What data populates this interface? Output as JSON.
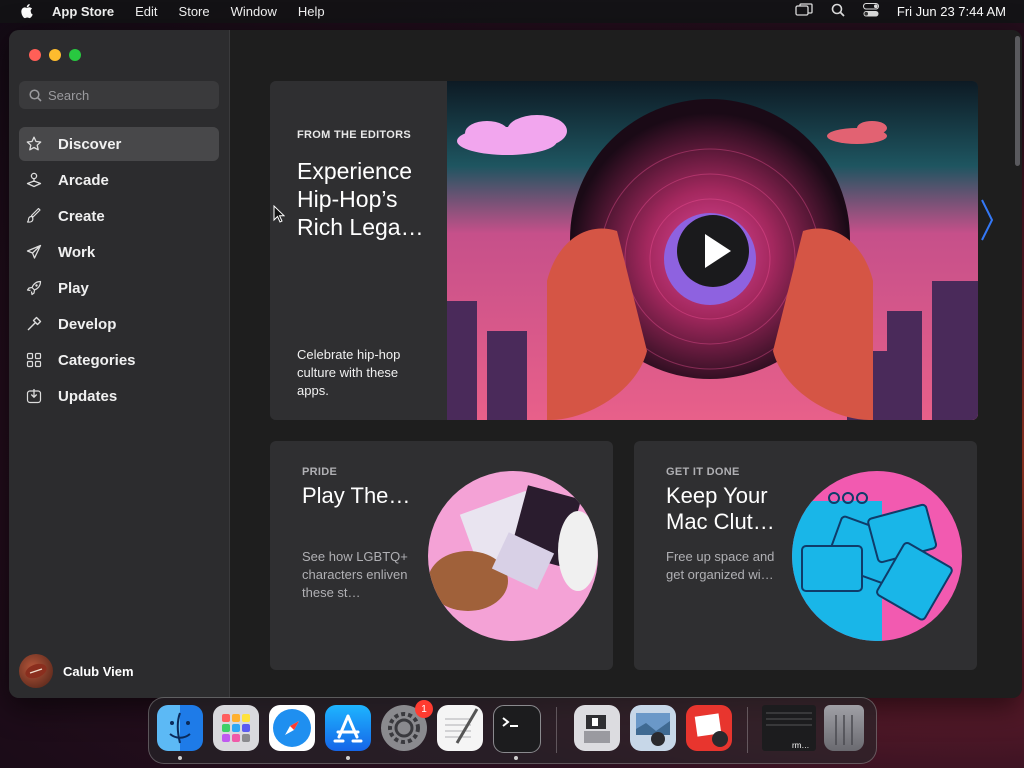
{
  "menubar": {
    "app_name": "App Store",
    "menus": [
      "Edit",
      "Store",
      "Window",
      "Help"
    ],
    "clock": "Fri Jun 23  7:44 AM"
  },
  "sidebar": {
    "search_placeholder": "Search",
    "items": [
      {
        "label": "Discover",
        "icon": "star-icon",
        "active": true
      },
      {
        "label": "Arcade",
        "icon": "joystick-icon"
      },
      {
        "label": "Create",
        "icon": "brush-icon"
      },
      {
        "label": "Work",
        "icon": "paper-plane-icon"
      },
      {
        "label": "Play",
        "icon": "rocket-icon"
      },
      {
        "label": "Develop",
        "icon": "hammer-icon"
      },
      {
        "label": "Categories",
        "icon": "grid-icon"
      },
      {
        "label": "Updates",
        "icon": "download-box-icon"
      }
    ],
    "user_name": "Calub Viem"
  },
  "hero": {
    "eyebrow": "FROM THE EDITORS",
    "title": "Experience Hip-Hop’s Rich Lega…",
    "subtitle": "Celebrate hip-hop culture with these apps."
  },
  "cards": [
    {
      "eyebrow": "PRIDE",
      "title": "Play The…",
      "subtitle": "See how LGBTQ+ characters enliven these st…"
    },
    {
      "eyebrow": "GET IT DONE",
      "title": "Keep Your Mac Clut…",
      "subtitle": "Free up space and get organized wi…"
    }
  ],
  "dock": {
    "apps": [
      "finder-icon",
      "launchpad-icon",
      "safari-icon",
      "app-store-icon",
      "system-settings-icon",
      "textedit-icon",
      "terminal-icon",
      "boot-camp-icon",
      "preview-icon",
      "photo-booth-icon",
      "screen-thumbnail-icon",
      "trash-icon"
    ],
    "settings_badge": "1",
    "thumbnail_label": "rm…"
  },
  "colors": {
    "accent": "#3478f6",
    "hero_magenta": "#e04a8a",
    "card_pink": "#f25ab0",
    "card_cyan": "#14b4e6"
  }
}
